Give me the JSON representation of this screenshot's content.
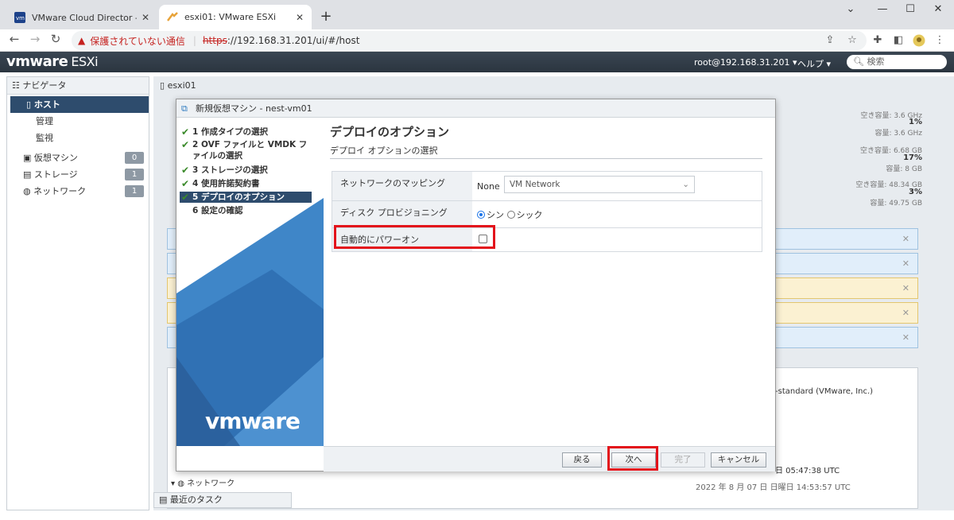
{
  "browser": {
    "tabs": [
      {
        "title": "VMware Cloud Director - 仮想マ",
        "active": false
      },
      {
        "title": "esxi01: VMware ESXi",
        "active": true
      }
    ],
    "url_scheme": "https",
    "url_rest": "://192.168.31.201/ui/#/host",
    "security_label": "保護されていない通信"
  },
  "esxi": {
    "logo_main": "vmware",
    "logo_sub": "ESXi",
    "user": "root@192.168.31.201 ▾",
    "help": "ヘルプ ▾",
    "search_placeholder": "検索"
  },
  "navigator": {
    "title": "ナビゲータ",
    "host_label": "ホスト",
    "host_subitems": [
      "管理",
      "監視"
    ],
    "items": [
      {
        "label": "仮想マシン",
        "count": "0"
      },
      {
        "label": "ストレージ",
        "count": "1"
      },
      {
        "label": "ネットワーク",
        "count": "1"
      }
    ]
  },
  "main": {
    "host_name": "esxi01",
    "right_stats": [
      {
        "label": "空き容量: 3.6 GHz"
      },
      {
        "label": "1%"
      },
      {
        "label": "容量: 3.6 GHz"
      },
      {
        "label": "空き容量: 6.68 GB"
      },
      {
        "label": "17%"
      },
      {
        "label": "容量: 8 GB"
      },
      {
        "label": "空き容量: 48.34 GB"
      },
      {
        "label": "3%"
      },
      {
        "label": "容量: 49.75 GB"
      }
    ],
    "behind_texts": [
      "-standard (VMware, Inc.)",
      "日 05:47:38 UTC",
      "2022 年 8 月 07 日 日曜日 14:53:57 UTC"
    ],
    "behind_network": "ネットワーク",
    "recent_tasks": "最近のタスク"
  },
  "dialog": {
    "title": "新規仮想マシン - nest-vm01",
    "steps": [
      {
        "label": "1 作成タイプの選択",
        "done": true
      },
      {
        "label": "2 OVF ファイルと VMDK ファイルの選択",
        "done": true
      },
      {
        "label": "3 ストレージの選択",
        "done": true
      },
      {
        "label": "4 使用許諾契約書",
        "done": true
      },
      {
        "label": "5 デプロイのオプション",
        "done": true,
        "current": true
      },
      {
        "label": "6 設定の確認",
        "done": false
      }
    ],
    "brand": "vmware",
    "page_title": "デプロイのオプション",
    "page_subtitle": "デプロイ オプションの選択",
    "options": {
      "network_label": "ネットワークのマッピング",
      "network_source": "None",
      "network_value": "VM Network",
      "disk_label": "ディスク プロビジョニング",
      "disk_thin": "シン",
      "disk_thick": "シック",
      "disk_selected": "シン",
      "power_label": "自動的にパワーオン",
      "power_checked": false
    },
    "buttons": {
      "back": "戻る",
      "next": "次へ",
      "finish": "完了",
      "cancel": "キャンセル"
    }
  },
  "colors": {
    "highlight": "#e3131b",
    "selection": "#2e4c6d",
    "check": "#3a8a2a"
  }
}
